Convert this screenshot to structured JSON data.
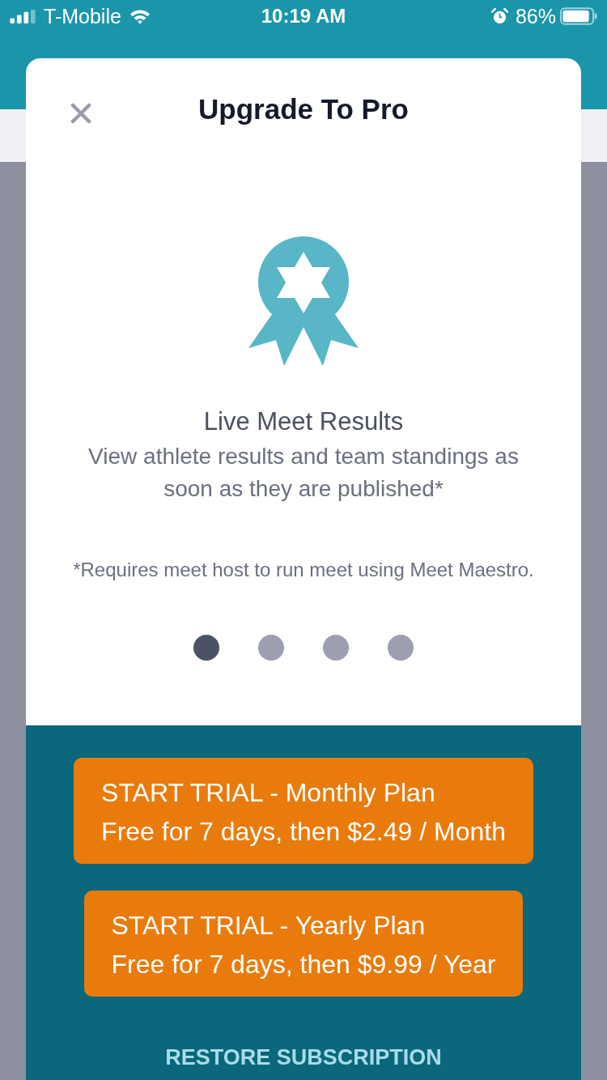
{
  "status_bar": {
    "carrier": "T-Mobile",
    "time": "10:19 AM",
    "battery": "86%"
  },
  "modal": {
    "title": "Upgrade To Pro",
    "feature": {
      "title": "Live Meet Results",
      "description": "View athlete results and team standings as soon as they are published*"
    },
    "footnote": "*Requires meet host to run meet using Meet Maestro.",
    "pages": [
      {
        "selected": true
      },
      {
        "selected": false
      },
      {
        "selected": false
      },
      {
        "selected": false
      }
    ],
    "plans": [
      {
        "title": "START TRIAL - Monthly Plan",
        "subtitle": "Free for 7 days, then $2.49 / Month"
      },
      {
        "title": "START TRIAL - Yearly Plan",
        "subtitle": "Free for 7 days, then $9.99 / Year"
      }
    ],
    "restore_link": "RESTORE SUBSCRIPTION"
  }
}
